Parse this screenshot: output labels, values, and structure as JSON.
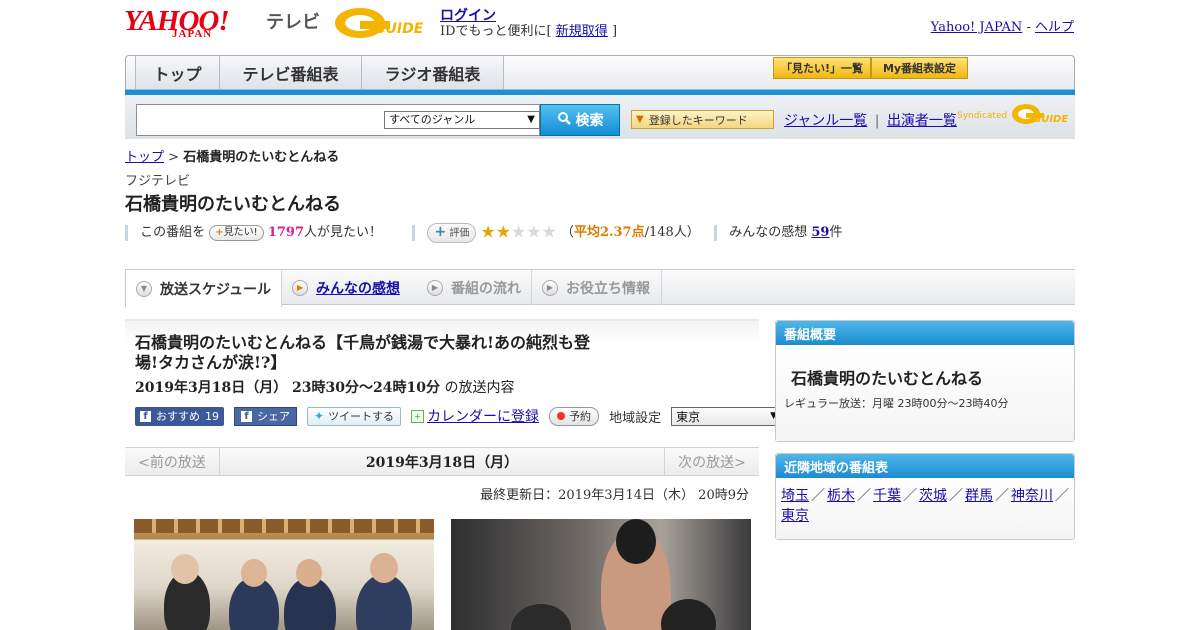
{
  "header": {
    "logo_text": "YAHOO!",
    "logo_sub": "JAPAN",
    "service": "テレビ",
    "gguide_logo": "G GUIDE",
    "login_link": "ログイン",
    "login_sub_prefix": "IDでもっと便利に[",
    "signup_link": "新規取得",
    "login_sub_suffix": "]",
    "yahoo_japan_link": "Yahoo! JAPAN",
    "separator": "-",
    "help_link": "ヘルプ"
  },
  "nav": {
    "tabs": [
      {
        "label": "トップ"
      },
      {
        "label": "テレビ番組表"
      },
      {
        "label": "ラジオ番組表"
      }
    ],
    "mitai_list": "「見たい!」一覧",
    "my_table": "My番組表設定"
  },
  "search": {
    "genre_selected": "すべてのジャンル",
    "search_button": "検索",
    "keyword_button": "登録したキーワード",
    "genre_list_link": "ジャンル一覧",
    "pipe": "|",
    "cast_list_link": "出演者一覧",
    "syndicated": "Syndicated",
    "gguide_small": "G GUIDE"
  },
  "breadcrumb": {
    "top": "トップ",
    "sep": ">",
    "current": "石橋貴明のたいむとんねる"
  },
  "program": {
    "station": "フジテレビ",
    "title": "石橋貴明のたいむとんねる",
    "mitai_prefix": "この番組を",
    "mitai_badge": "見たい!",
    "mitai_count": "1797",
    "mitai_suffix": "人が見たい！",
    "eval_badge": "評価",
    "rating_stars": 2,
    "rating_max": 5,
    "avg_open": "（",
    "avg_label": "平均2.37点",
    "avg_count": "/148人）",
    "impressions_prefix": "みんなの感想",
    "impressions_count": "59",
    "impressions_suffix": "件"
  },
  "subtabs": [
    {
      "label": "放送スケジュール"
    },
    {
      "label": "みんなの感想"
    },
    {
      "label": "番組の流れ"
    },
    {
      "label": "お役立ち情報"
    }
  ],
  "episode": {
    "title": "石橋貴明のたいむとんねる【千鳥が銭湯で大暴れ!あの純烈も登場!タカさんが涙!?】",
    "time": "2019年3月18日（月） 23時30分～24時10分",
    "time_suffix": "の放送内容",
    "fb_recommend": "おすすめ",
    "fb_count": "19",
    "fb_share": "シェア",
    "tweet": "ツイートする",
    "calendar_link": "カレンダーに登録",
    "reserve": "予約",
    "region_label": "地域設定",
    "region_selected": "東京"
  },
  "pager": {
    "prev": "<前の放送",
    "date": "2019年3月18日（月）",
    "next": "次の放送>"
  },
  "updated": "最終更新日：2019年3月14日（木） 20時9分",
  "overview": {
    "heading": "番組概要",
    "title": "石橋貴明のたいむとんねる",
    "regular": "レギュラー放送：月曜 23時00分～23時40分"
  },
  "nearby": {
    "heading": "近隣地域の番組表",
    "links": [
      "埼玉",
      "栃木",
      "千葉",
      "茨城",
      "群馬",
      "神奈川",
      "東京"
    ],
    "slash": "／"
  },
  "colors": {
    "accent_blue": "#1d8fd2",
    "yahoo_red": "#e60012",
    "mitai_pink": "#d6228a",
    "star_gold": "#e2a800"
  }
}
